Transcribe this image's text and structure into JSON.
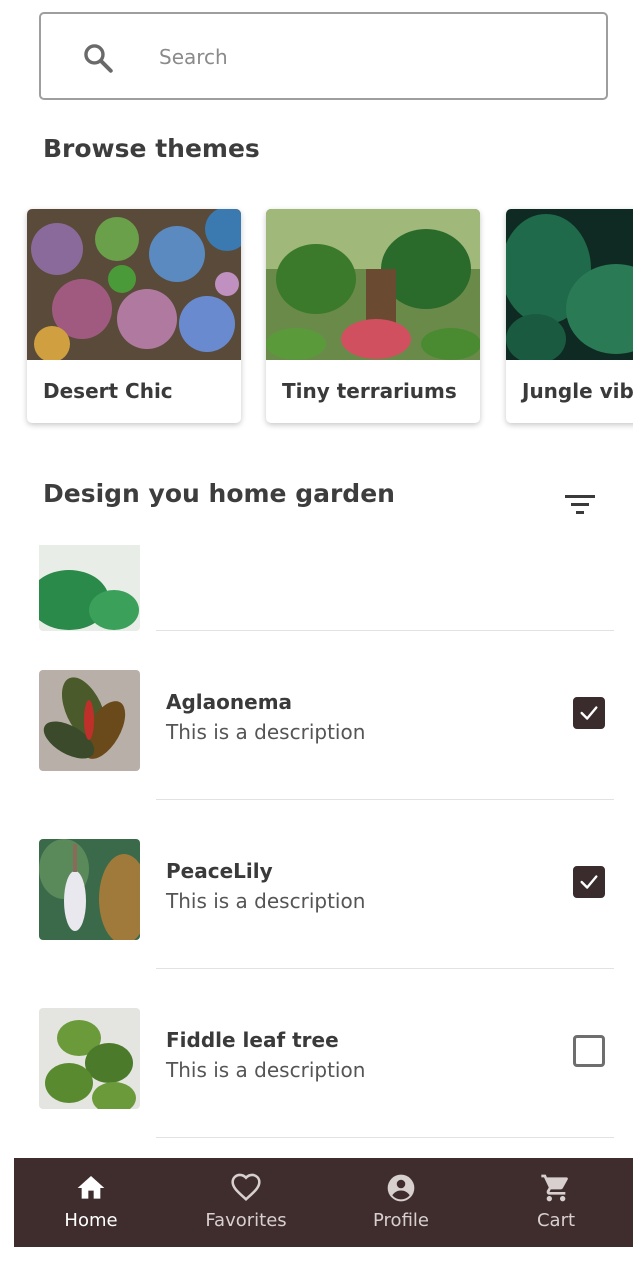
{
  "search": {
    "placeholder": "Search",
    "icon": "search-icon"
  },
  "browse": {
    "title": "Browse themes",
    "themes": [
      {
        "label": "Desert Chic"
      },
      {
        "label": "Tiny terrariums"
      },
      {
        "label": "Jungle vibes"
      }
    ]
  },
  "design": {
    "title": "Design you home garden",
    "filter_icon": "filter-icon"
  },
  "plants": [
    {
      "name": "Aglaonema",
      "description": "This is a description",
      "checked": true
    },
    {
      "name": "PeaceLily",
      "description": "This is a description",
      "checked": true
    },
    {
      "name": "Fiddle leaf tree",
      "description": "This is a description",
      "checked": false
    }
  ],
  "nav": {
    "items": [
      {
        "label": "Home",
        "icon": "home-icon",
        "active": true
      },
      {
        "label": "Favorites",
        "icon": "heart-icon",
        "active": false
      },
      {
        "label": "Profile",
        "icon": "account-circle-icon",
        "active": false
      },
      {
        "label": "Cart",
        "icon": "cart-icon",
        "active": false
      }
    ]
  },
  "colors": {
    "accent": "#3f2d2e",
    "checkbox": "#3a2b2c"
  }
}
